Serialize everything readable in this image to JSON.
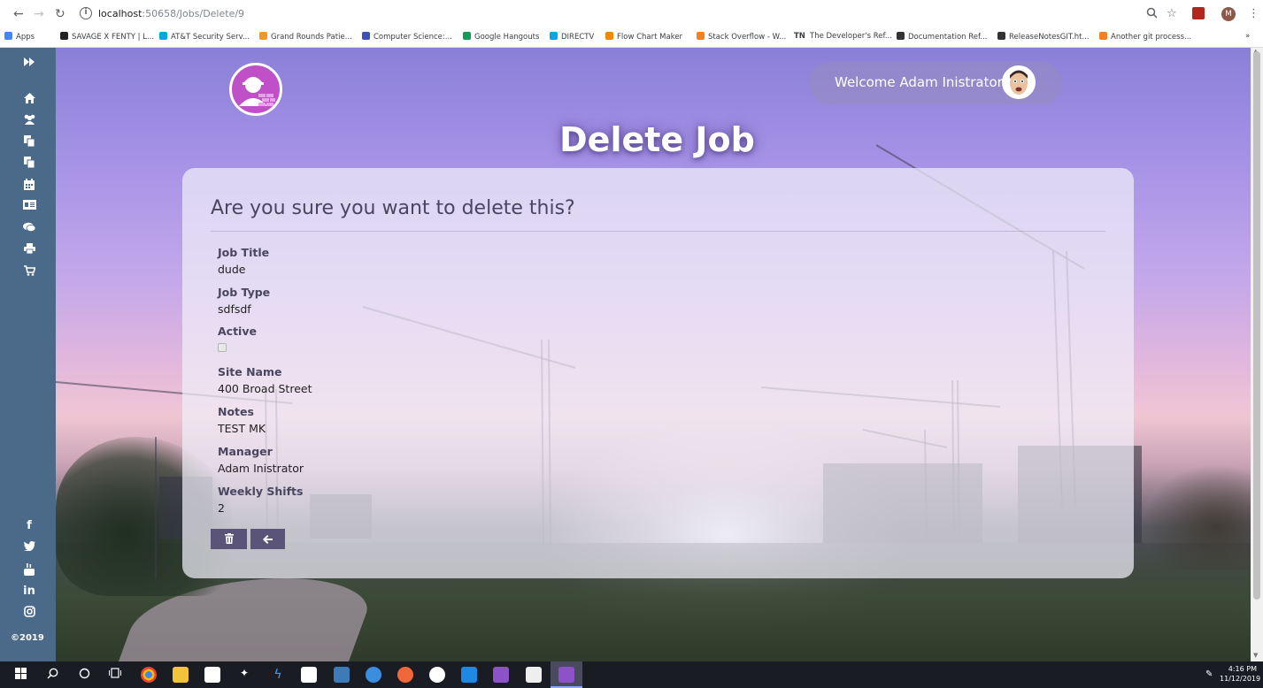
{
  "browser": {
    "url_host": "localhost",
    "url_port_path": ":50658/Jobs/Delete/9",
    "bookmarks": [
      {
        "label": "Apps",
        "color": "#4285f4"
      },
      {
        "label": "SAVAGE X FENTY | L...",
        "color": "#222222"
      },
      {
        "label": "AT&T Security Serv...",
        "color": "#00a8e0"
      },
      {
        "label": "Grand Rounds Patie...",
        "color": "#f29a1d"
      },
      {
        "label": "Computer Science:...",
        "color": "#3f51b5"
      },
      {
        "label": "Google Hangouts",
        "color": "#0f9d58"
      },
      {
        "label": "DIRECTV",
        "color": "#00a8e0"
      },
      {
        "label": "Flow Chart Maker",
        "color": "#f08705"
      },
      {
        "label": "Stack Overflow - W...",
        "color": "#f48024"
      },
      {
        "label": "The Developer's Ref...",
        "color": "#222222"
      },
      {
        "label": "Documentation Ref...",
        "color": "#333333"
      },
      {
        "label": "ReleaseNotesGIT.ht...",
        "color": "#333333"
      },
      {
        "label": "Another git process...",
        "color": "#f48024"
      }
    ],
    "tn_badge": "TN",
    "profile_initial": "M"
  },
  "header": {
    "welcome": "Welcome Adam Inistrator",
    "page_title": "Delete Job"
  },
  "card": {
    "question": "Are you sure you want to delete this?",
    "fields": [
      {
        "label": "Job Title",
        "value": "dude"
      },
      {
        "label": "Job Type",
        "value": "sdfsdf"
      },
      {
        "label": "Active",
        "value": ""
      },
      {
        "label": "Site Name",
        "value": "400 Broad Street"
      },
      {
        "label": "Notes",
        "value": "TEST MK"
      },
      {
        "label": "Manager",
        "value": "Adam Inistrator"
      },
      {
        "label": "Weekly Shifts",
        "value": "2"
      }
    ],
    "active_checked": false
  },
  "sidebar": {
    "top_icons": [
      "expand-icon",
      "home-icon",
      "users-icon",
      "copy-icon",
      "copy-icon",
      "calendar-icon",
      "id-card-icon",
      "chat-icon",
      "print-icon",
      "cart-icon"
    ],
    "social_icons": [
      "facebook-icon",
      "twitter-icon",
      "youtube-icon",
      "linkedin-icon",
      "instagram-icon"
    ],
    "copyright": "©2019"
  },
  "taskbar": {
    "time": "4:16 PM",
    "date": "11/12/2019"
  },
  "colors": {
    "sidebar": "#4b6a8a",
    "button": "#5a5479",
    "logo": "#c050c8"
  }
}
